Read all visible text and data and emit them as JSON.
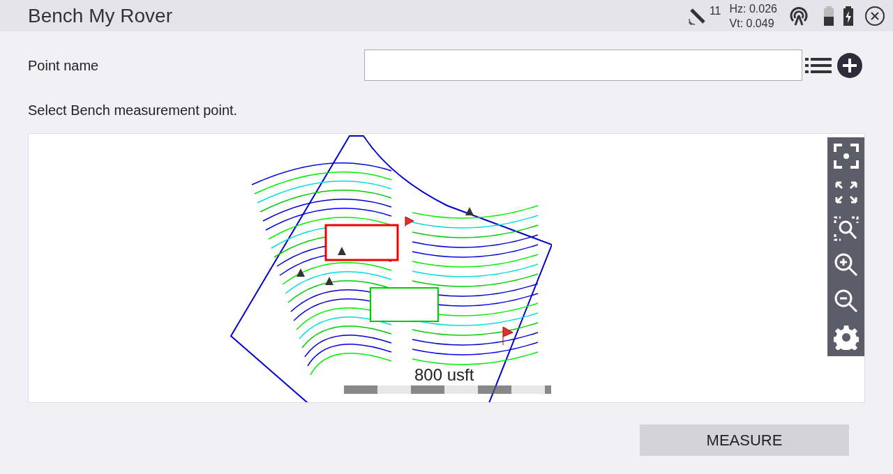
{
  "window": {
    "title": "Bench My Rover"
  },
  "status": {
    "satellites": "11",
    "hz": "Hz: 0.026",
    "vt": "Vt: 0.049"
  },
  "point_name": {
    "label": "Point name"
  },
  "instruction": "Select Bench measurement point.",
  "map": {
    "scale_label": "800 usft",
    "tools": [
      {
        "kind": "focus"
      },
      {
        "kind": "extents"
      },
      {
        "kind": "zoom-window"
      },
      {
        "kind": "zoom-in"
      },
      {
        "kind": "zoom-out"
      },
      {
        "kind": "settings"
      }
    ]
  },
  "buttons": [
    "MEASURE"
  ]
}
